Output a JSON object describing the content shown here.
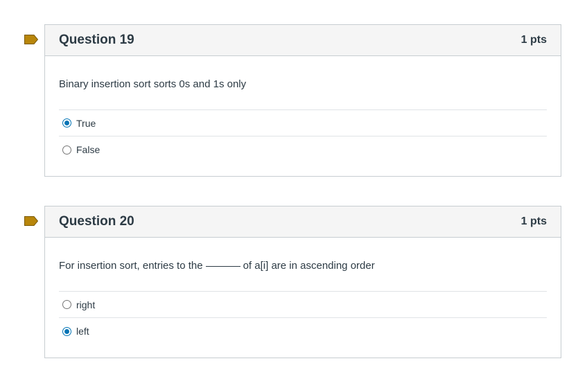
{
  "questions": [
    {
      "title": "Question 19",
      "points": "1 pts",
      "text": "Binary insertion sort sorts 0s and 1s only",
      "answers": [
        {
          "label": "True",
          "selected": true
        },
        {
          "label": "False",
          "selected": false
        }
      ]
    },
    {
      "title": "Question 20",
      "points": "1 pts",
      "text_before": "For insertion sort, entries to the",
      "text_after": "of a[i] are in ascending order",
      "answers": [
        {
          "label": "right",
          "selected": false
        },
        {
          "label": "left",
          "selected": true
        }
      ]
    }
  ],
  "colors": {
    "flag": "#b8860b",
    "accent": "#0374b5"
  }
}
